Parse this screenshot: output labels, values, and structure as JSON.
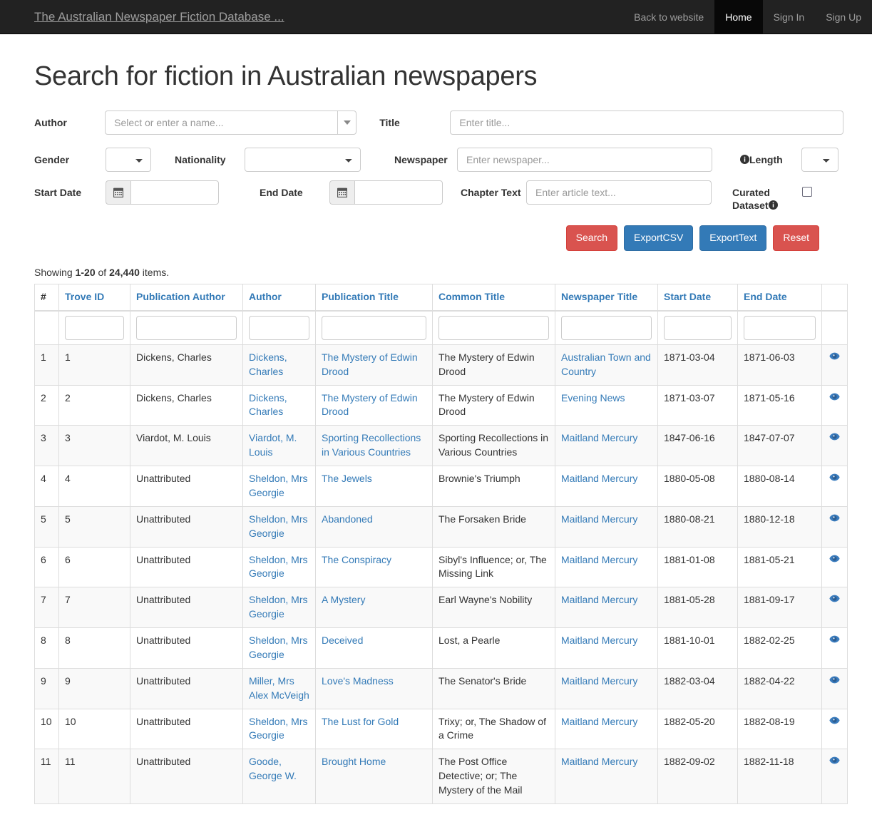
{
  "navbar": {
    "brand": "The Australian Newspaper Fiction Database ...",
    "links": [
      {
        "label": "Back to website",
        "active": false
      },
      {
        "label": "Home",
        "active": true
      },
      {
        "label": "Sign In",
        "active": false
      },
      {
        "label": "Sign Up",
        "active": false
      }
    ]
  },
  "page": {
    "title": "Search for fiction in Australian newspapers"
  },
  "form": {
    "author_label": "Author",
    "author_placeholder": "Select or enter a name...",
    "title_label": "Title",
    "title_placeholder": "Enter title...",
    "gender_label": "Gender",
    "gender_value": "",
    "nationality_label": "Nationality",
    "nationality_value": "",
    "newspaper_label": "Newspaper",
    "newspaper_placeholder": "Enter newspaper...",
    "length_label": "Length",
    "length_value": "",
    "start_date_label": "Start Date",
    "start_date_value": "",
    "end_date_label": "End Date",
    "end_date_value": "",
    "chapter_text_label": "Chapter Text",
    "chapter_text_placeholder": "Enter article text...",
    "curated_dataset_label": "Curated Dataset",
    "curated_dataset_checked": false
  },
  "buttons": {
    "search": "Search",
    "export_csv": "ExportCSV",
    "export_text": "ExportText",
    "reset": "Reset"
  },
  "colors": {
    "primary_blue": "#337ab7",
    "danger_red": "#d9534f",
    "navbar_bg": "#222222",
    "link_blue": "#337ab7"
  },
  "summary": {
    "prefix": "Showing ",
    "range": "1-20",
    "middle": " of ",
    "total": "24,440",
    "suffix": " items."
  },
  "table": {
    "columns": [
      "#",
      "Trove ID",
      "Publication Author",
      "Author",
      "Publication Title",
      "Common Title",
      "Newspaper Title",
      "Start Date",
      "End Date",
      ""
    ],
    "filter_values": [
      "",
      "",
      "",
      "",
      "",
      "",
      "",
      ""
    ],
    "rows": [
      {
        "num": "1",
        "trove_id": "1",
        "publication_author": "Dickens, Charles",
        "author": "Dickens, Charles",
        "publication_title": "The Mystery of Edwin Drood",
        "common_title": "The Mystery of Edwin Drood",
        "newspaper_title": "Australian Town and Country",
        "start_date": "1871-03-04",
        "end_date": "1871-06-03"
      },
      {
        "num": "2",
        "trove_id": "2",
        "publication_author": "Dickens, Charles",
        "author": "Dickens, Charles",
        "publication_title": "The Mystery of Edwin Drood",
        "common_title": "The Mystery of Edwin Drood",
        "newspaper_title": "Evening News",
        "start_date": "1871-03-07",
        "end_date": "1871-05-16"
      },
      {
        "num": "3",
        "trove_id": "3",
        "publication_author": "Viardot, M. Louis",
        "author": "Viardot, M. Louis",
        "publication_title": "Sporting Recollections in Various Countries",
        "common_title": "Sporting Recollections in Various Countries",
        "newspaper_title": "Maitland Mercury",
        "start_date": "1847-06-16",
        "end_date": "1847-07-07"
      },
      {
        "num": "4",
        "trove_id": "4",
        "publication_author": "Unattributed",
        "author": "Sheldon, Mrs Georgie",
        "publication_title": "The Jewels",
        "common_title": "Brownie's Triumph",
        "newspaper_title": "Maitland Mercury",
        "start_date": "1880-05-08",
        "end_date": "1880-08-14"
      },
      {
        "num": "5",
        "trove_id": "5",
        "publication_author": "Unattributed",
        "author": "Sheldon, Mrs Georgie",
        "publication_title": "Abandoned",
        "common_title": "The Forsaken Bride",
        "newspaper_title": "Maitland Mercury",
        "start_date": "1880-08-21",
        "end_date": "1880-12-18"
      },
      {
        "num": "6",
        "trove_id": "6",
        "publication_author": "Unattributed",
        "author": "Sheldon, Mrs Georgie",
        "publication_title": "The Conspiracy",
        "common_title": "Sibyl's Influence; or, The Missing Link",
        "newspaper_title": "Maitland Mercury",
        "start_date": "1881-01-08",
        "end_date": "1881-05-21"
      },
      {
        "num": "7",
        "trove_id": "7",
        "publication_author": "Unattributed",
        "author": "Sheldon, Mrs Georgie",
        "publication_title": "A Mystery",
        "common_title": "Earl Wayne's Nobility",
        "newspaper_title": "Maitland Mercury",
        "start_date": "1881-05-28",
        "end_date": "1881-09-17"
      },
      {
        "num": "8",
        "trove_id": "8",
        "publication_author": "Unattributed",
        "author": "Sheldon, Mrs Georgie",
        "publication_title": "Deceived",
        "common_title": "Lost, a Pearle",
        "newspaper_title": "Maitland Mercury",
        "start_date": "1881-10-01",
        "end_date": "1882-02-25"
      },
      {
        "num": "9",
        "trove_id": "9",
        "publication_author": "Unattributed",
        "author": "Miller, Mrs Alex McVeigh",
        "publication_title": "Love's Madness",
        "common_title": "The Senator's Bride",
        "newspaper_title": "Maitland Mercury",
        "start_date": "1882-03-04",
        "end_date": "1882-04-22"
      },
      {
        "num": "10",
        "trove_id": "10",
        "publication_author": "Unattributed",
        "author": "Sheldon, Mrs Georgie",
        "publication_title": "The Lust for Gold",
        "common_title": "Trixy; or, The Shadow of a Crime",
        "newspaper_title": "Maitland Mercury",
        "start_date": "1882-05-20",
        "end_date": "1882-08-19"
      },
      {
        "num": "11",
        "trove_id": "11",
        "publication_author": "Unattributed",
        "author": "Goode, George W.",
        "publication_title": "Brought Home",
        "common_title": "The Post Office Detective; or; The Mystery of the Mail",
        "newspaper_title": "Maitland Mercury",
        "start_date": "1882-09-02",
        "end_date": "1882-11-18"
      }
    ]
  }
}
